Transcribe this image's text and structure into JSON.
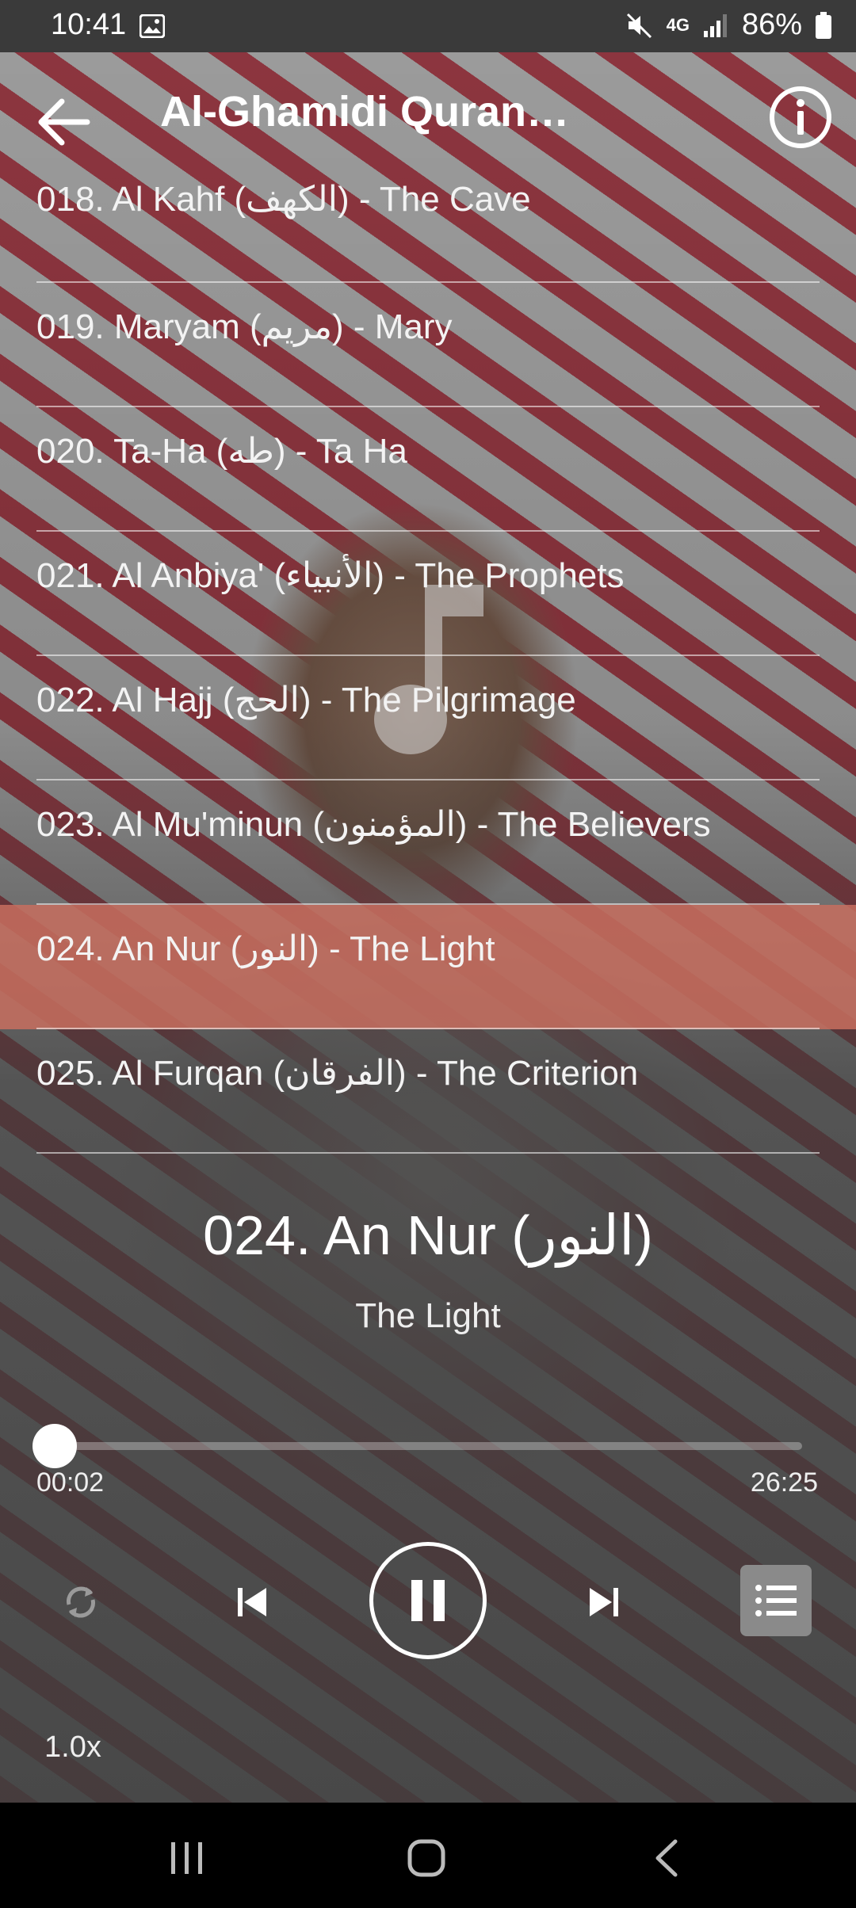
{
  "status_bar": {
    "time": "10:41",
    "battery": "86%",
    "network": "4G"
  },
  "app_bar": {
    "title": "Al-Ghamidi Quran ..."
  },
  "tracks": [
    {
      "label": "018. Al Kahf (الكهف) - The Cave",
      "active": false
    },
    {
      "label": "019. Maryam (مريم) - Mary",
      "active": false
    },
    {
      "label": "020. Ta-Ha (طه) - Ta Ha",
      "active": false
    },
    {
      "label": "021. Al Anbiya' (الأنبياء) - The Prophets",
      "active": false
    },
    {
      "label": "022. Al Hajj (الحج) - The Pilgrimage",
      "active": false
    },
    {
      "label": "023. Al Mu'minun (المؤمنون) - The Believers",
      "active": false
    },
    {
      "label": "024. An Nur (النور) - The Light",
      "active": true
    },
    {
      "label": "025. Al Furqan (الفرقان) - The Criterion",
      "active": false
    }
  ],
  "now_playing": {
    "title": "024. An Nur (النور)",
    "subtitle": "The Light",
    "elapsed": "00:02",
    "total": "26:25",
    "progress_fraction": 0.001
  },
  "controls": {
    "speed": "1.0x"
  },
  "colors": {
    "active_row": "#c86e5f",
    "background": "#3a3a3a"
  }
}
